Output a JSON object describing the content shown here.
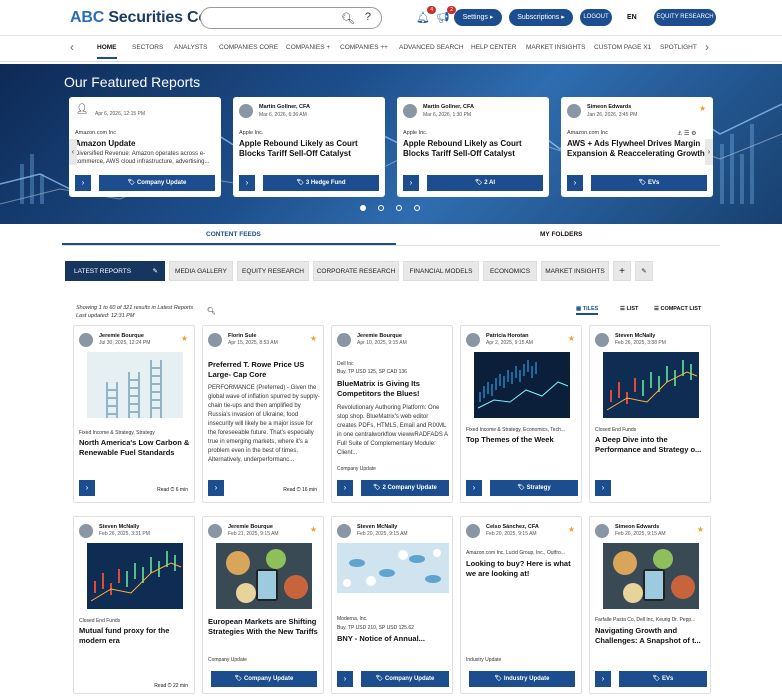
{
  "header": {
    "brand_abc": "ABC",
    "brand_rest": " Securities Co.",
    "notif_count": "4",
    "notif_count2": "2",
    "settings": "Settings",
    "subscriptions": "Subscriptions",
    "logout": "LOGOUT",
    "lang": "EN",
    "equity_research": "EQUITY RESEARCH"
  },
  "nav": [
    "HOME",
    "SECTORS",
    "ANALYSTS",
    "COMPANIES CORE",
    "COMPANIES +",
    "COMPANIES ++",
    "ADVANCED SEARCH",
    "HELP CENTER",
    "MARKET INSIGHTS",
    "CUSTOM PAGE X1",
    "SPOTLIGHT"
  ],
  "hero": {
    "title": "Our Featured Reports",
    "cards": [
      {
        "author": "",
        "date": "Apr 6, 2026, 12:15 PM",
        "company": "Amazon.com Inc",
        "title": "Amazon Update",
        "summary": "Diversified Revenue: Amazon operates across e-commerce, AWS cloud infrastructure, advertising...",
        "tag": "Company Update"
      },
      {
        "author": "Martin Gollner, CFA",
        "date": "Mar 6, 2026, 6:36 AM",
        "company": "Apple Inc.",
        "title": "Apple Rebound Likely as Court Blocks Tariff Sell-Off Catalyst",
        "summary": "",
        "tag": "3  Hedge Fund"
      },
      {
        "author": "Martin Gollner, CFA",
        "date": "Mar 6, 2026, 1:30 PM",
        "company": "Apple Inc.",
        "title": "Apple Rebound Likely as Court Blocks Tariff Sell-Off Catalyst",
        "summary": "",
        "tag": "2  AI"
      },
      {
        "author": "Simeon Edwards",
        "date": "Jan 26, 2026, 3:45 PM",
        "company": "Amazon.com Inc",
        "title": "AWS + Ads Flywheel Drives Margin Expansion & Reaccelerating Growth",
        "summary": "",
        "tag": "EVs"
      }
    ]
  },
  "tabs": {
    "content_feeds": "CONTENT FEEDS",
    "my_folders": "MY FOLDERS"
  },
  "chips": [
    "LATEST REPORTS",
    "MEDIA GALLERY",
    "EQUITY RESEARCH",
    "CORPORATE RESEARCH",
    "FINANCIAL MODELS",
    "ECONOMICS",
    "MARKET INSIGHTS"
  ],
  "results": {
    "line1": "Showing 1 to 60 of 321 results in Latest Reports",
    "line2": "Last updated: 12:31 PM"
  },
  "views": {
    "tiles": "TILES",
    "list": "LIST",
    "compact": "COMPACT LIST"
  },
  "cards": [
    {
      "author": "Jeremie Bourque",
      "date": "Jul 30, 2025, 12:24 PM",
      "category": "Fixed Income & Strategy, Strategy",
      "title": "North America's Low Carbon & Renewable Fuel Standards",
      "body": "",
      "ctype": "",
      "tag": "",
      "read": "Read",
      "mins": "6 min",
      "pic": "ladder"
    },
    {
      "author": "Florin Sule",
      "date": "Apr 15, 2025, 8:53 AM",
      "category": "",
      "title": "Preferred T. Rowe Price US Large- Cap Core",
      "body": "PERFORMANCE (Preferred) - Given the global wave of inflation spurred by supply-chain tie-ups and then amplified by Russia's invasion of Ukraine, food insecurity will likely be a major issue for the foreseeable future. That's especially true in emerging markets, where it's a problem even in the best of times. Alternatively, underperformanc...",
      "ctype": "",
      "tag": "",
      "read": "Read",
      "mins": "16 min",
      "pic": ""
    },
    {
      "author": "Jeremie Bourque",
      "date": "Apr 10, 2025, 9:15 AM",
      "category": "Dell Inc",
      "meta": "Buy, TP USD 125, SP CAD 136",
      "title": "BlueMatrix is Giving Its Competitors the Blues!",
      "body": "Revolutionary Authoring Platform: One stop shop. BlueMatrix's web editor creates PDFs, HTML5, Email and RIXML in one centralworkflow viewwRADFADS A Full Suite of Complementary Module: Client...",
      "ctype": "Company Update",
      "tag": "2  Company Update",
      "read": "",
      "mins": "",
      "pic": ""
    },
    {
      "author": "Patricia Horotan",
      "date": "Apr 2, 2025, 9:15 AM",
      "category": "Fixed Income & Strategy, Economics, Tech...",
      "title": "Top Themes of the Week",
      "body": "",
      "ctype": "",
      "tag": "Strategy",
      "read": "",
      "mins": "",
      "pic": "chart1"
    },
    {
      "author": "Steven McNally",
      "date": "Feb 26, 2025, 3:38 PM",
      "category": "Closed End Funds",
      "title": "A Deep Dive into the Performance and Strategy o...",
      "body": "",
      "ctype": "",
      "tag": "",
      "read": "",
      "mins": "",
      "pic": "chart2"
    },
    {
      "author": "Steven McNally",
      "date": "Feb 26, 2025, 3:31 PM",
      "category": "Closed End Funds",
      "title": "Mutual fund proxy for the modern era",
      "body": "",
      "ctype": "",
      "tag": "",
      "read": "Read",
      "mins": "22 min",
      "pic": "chart2"
    },
    {
      "author": "Jeremie Bourque",
      "date": "Feb 21, 2025, 9:15 AM",
      "category": "",
      "title": "European Markets are Shifting Strategies With the New Tariffs",
      "body": "",
      "ctype": "Company Update",
      "tag": "Company Update",
      "read": "",
      "mins": "",
      "pic": "food"
    },
    {
      "author": "Steven McNally",
      "date": "Feb 20, 2025, 9:15 AM",
      "category": "Moderna, Inc.",
      "meta": "Buy, TP USD 210, SP USD 125.62",
      "title": "BNY - Notice of Annual...",
      "body": "",
      "ctype": "",
      "tag": "Company Update",
      "read": "",
      "mins": "",
      "pic": "pills"
    },
    {
      "author": "Celso Sánchez, CFA",
      "date": "Feb 20, 2025, 9:15 AM",
      "category": "Amazon.com Inc, Lucid Group, Inc., Outfro...",
      "title": "Looking to buy? Here is what we are looking at!",
      "body": "",
      "ctype": "Industry Update",
      "tag": "Industry Update",
      "read": "",
      "mins": "",
      "pic": ""
    },
    {
      "author": "Simeon Edwards",
      "date": "Feb 20, 2025, 9:15 AM",
      "category": "Farfalle Pasta Co, Dell Inc, Keurig Dr. Pepp...",
      "title": "Navigating Growth and Challenges: A Snapshot of t...",
      "body": "",
      "ctype": "",
      "tag": "EVs",
      "read": "",
      "mins": "",
      "pic": "food"
    }
  ]
}
